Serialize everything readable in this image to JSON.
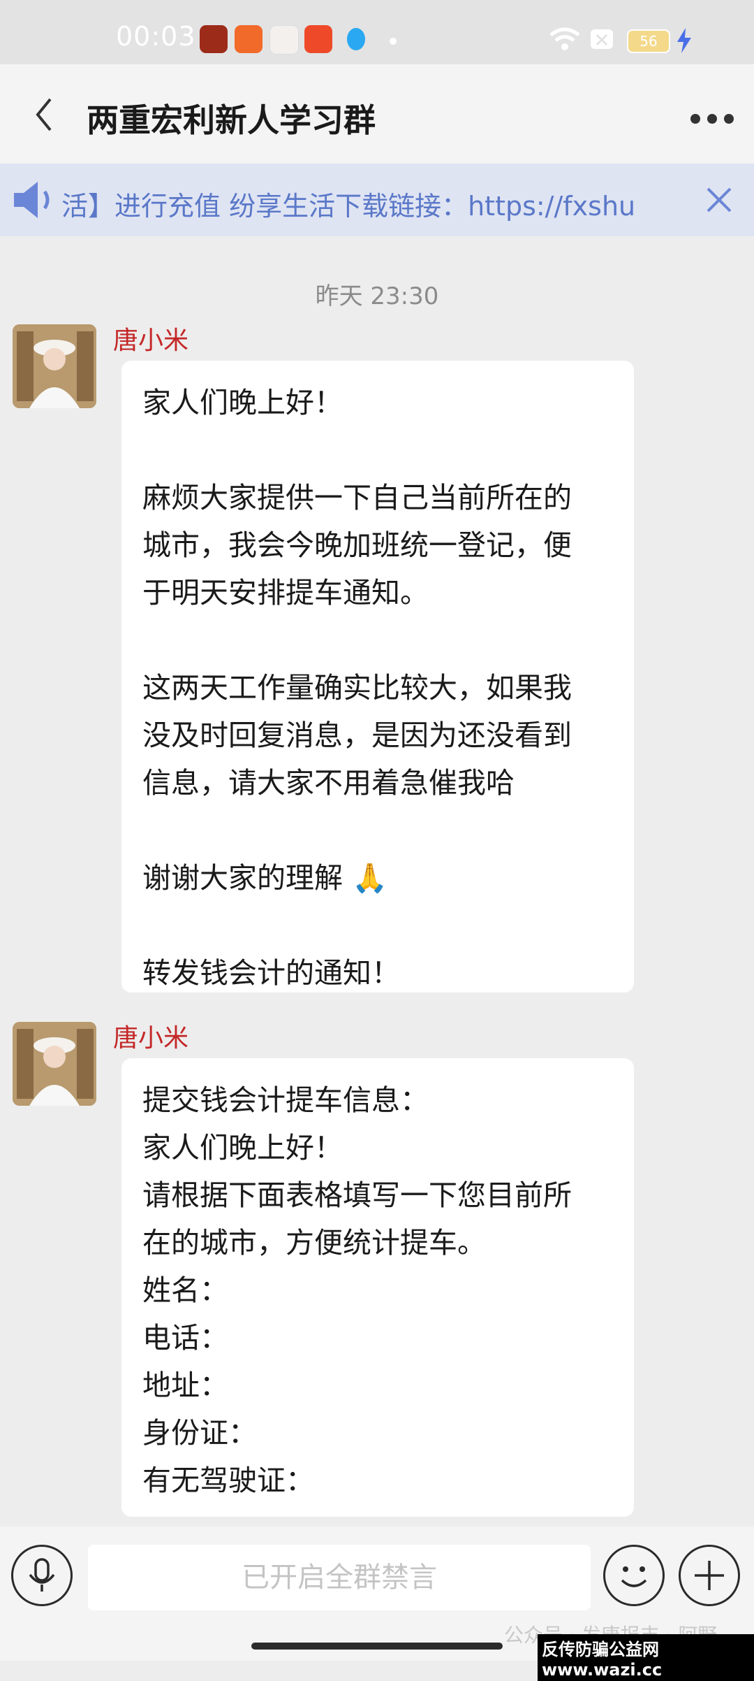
{
  "status_bar": {
    "time": "00:03",
    "battery": "56"
  },
  "header": {
    "title": "两重宏利新人学习群"
  },
  "notice": {
    "text": "活】进行充值 纷享生活下载链接：https://fxshu"
  },
  "timestamp": "昨天 23:30",
  "messages": [
    {
      "sender": "唐小米",
      "lines": [
        "家人们晚上好！",
        "",
        "麻烦大家提供一下自己当前所在的",
        "城市，我会今晚加班统一登记，便",
        "于明天安排提车通知。",
        "",
        "这两天工作量确实比较大，如果我",
        "没及时回复消息，是因为还没看到",
        "信息，请大家不用着急催我哈",
        "",
        "谢谢大家的理解 🙏",
        "",
        "转发钱会计的通知！"
      ]
    },
    {
      "sender": "唐小米",
      "lines": [
        "提交钱会计提车信息：",
        "家人们晚上好！",
        "请根据下面表格填写一下您目前所",
        "在的城市，方便统计提车。",
        "姓名：",
        "电话：",
        "地址：",
        "身份证：",
        "有无驾驶证："
      ]
    }
  ],
  "input_bar": {
    "placeholder": "已开启全群禁言"
  },
  "watermark": "公众号 · 发唐报丰 · 阿野",
  "site_label": "反传防骗公益网 www.wazi.cc"
}
